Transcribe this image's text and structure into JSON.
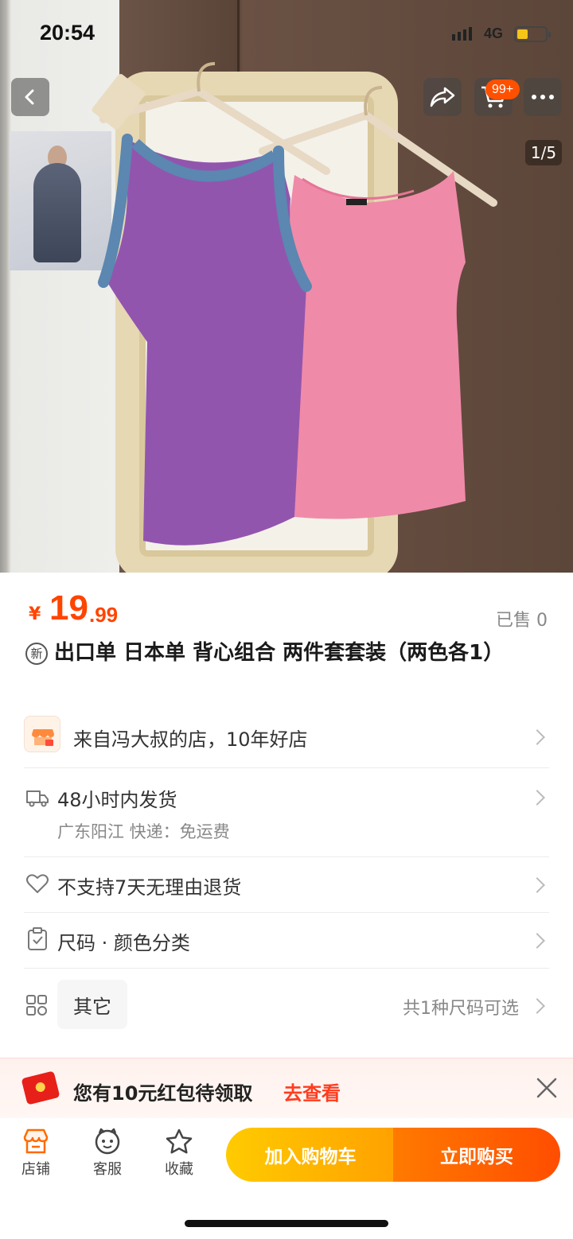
{
  "status_bar": {
    "time": "20:54",
    "network": "4G"
  },
  "gallery": {
    "counter": "1/5",
    "cart_badge": "99+"
  },
  "product": {
    "currency": "¥",
    "price_int": "19",
    "price_dec": ".99",
    "sold": "已售 0",
    "new_tag": "新",
    "title": "出口单 日本单 背心组合 两件套套装（两色各1）"
  },
  "store": {
    "label": "来自冯大叔的店，10年好店"
  },
  "shipping": {
    "label": "48小时内发货",
    "sub": "广东阳江  快递：免运费"
  },
  "returns": {
    "label": "不支持7天无理由退货"
  },
  "spec": {
    "label": "尺码 · 颜色分类"
  },
  "options": {
    "chip": "其它",
    "note": "共1种尺码可选"
  },
  "coupon": {
    "text": "您有10元红包待领取",
    "link": "去查看"
  },
  "bottom_bar": {
    "store": "店铺",
    "service": "客服",
    "favorite": "收藏",
    "add_to_cart": "加入购物车",
    "buy_now": "立即购买"
  },
  "colors": {
    "accent": "#ff4400",
    "cart_button": "#ffb300",
    "buy_button": "#ff5a00",
    "purple_tank": "#8a4fa8",
    "pink_tank": "#f07fa3"
  }
}
